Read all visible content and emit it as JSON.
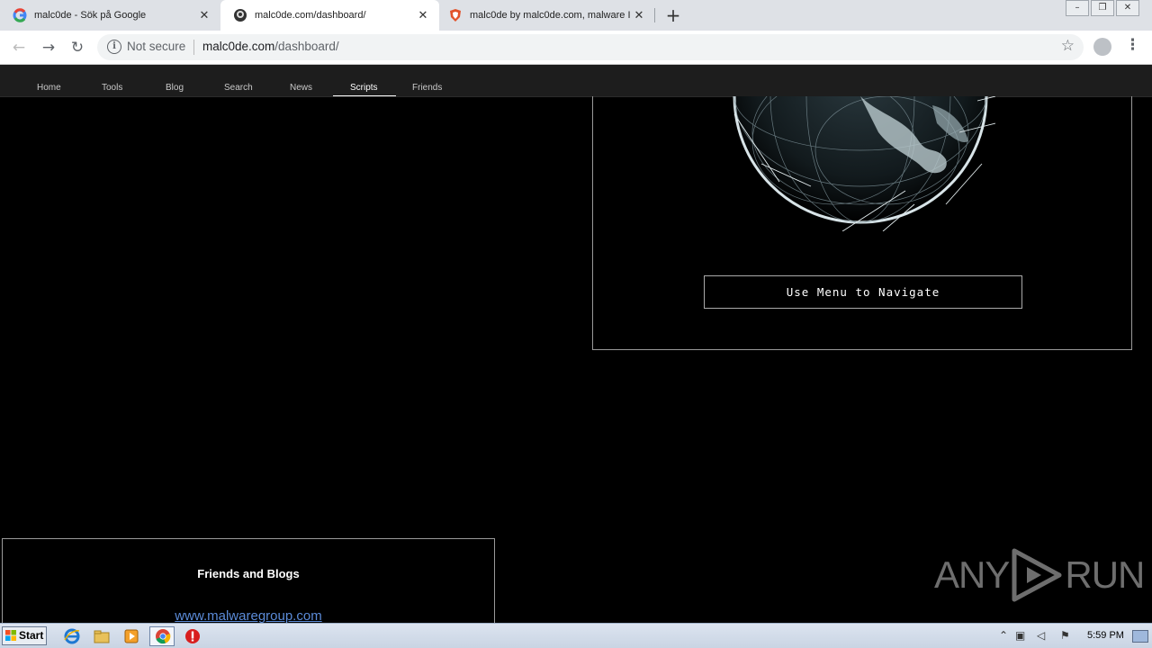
{
  "browser": {
    "tabs": [
      {
        "title": "malc0de - Sök på Google",
        "icon": "google-icon"
      },
      {
        "title": "malc0de.com/dashboard/",
        "icon": "site-icon"
      },
      {
        "title": "malc0de by malc0de.com, malware I",
        "icon": "brave-shield-icon"
      }
    ],
    "close_glyph": "✕",
    "security_label": "Not secure",
    "url_host": "malc0de.com",
    "url_path": "/dashboard/"
  },
  "site": {
    "nav": [
      "Home",
      "Tools",
      "Blog",
      "Search",
      "News",
      "Scripts",
      "Friends"
    ],
    "active_nav": "Scripts",
    "navigate_box": "Use Menu to Navigate",
    "friends_title": "Friends and Blogs",
    "friends_link": "www.malwaregroup.com"
  },
  "watermark": {
    "left": "ANY",
    "right": "RUN"
  },
  "taskbar": {
    "start_label": "Start",
    "clock": "5:59 PM"
  },
  "colors": {
    "accent_link": "#5b8bd8",
    "page_bg": "#000000"
  }
}
